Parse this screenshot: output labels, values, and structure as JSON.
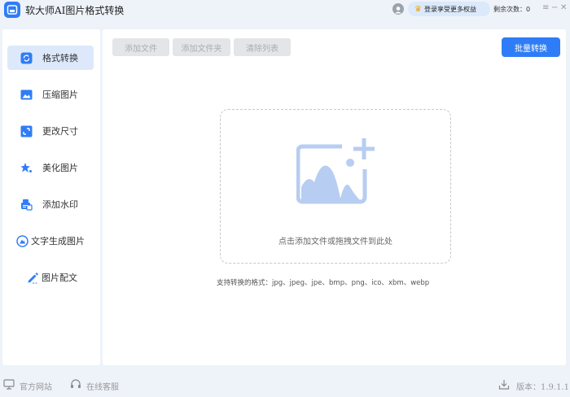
{
  "app": {
    "title": "软大师AI图片格式转换",
    "login_label": "登录享受更多权益",
    "remaining_label": "剩余次数：0"
  },
  "window": {
    "menu_glyph": "≡",
    "minimize_glyph": "−",
    "close_glyph": "✕"
  },
  "sidebar": {
    "items": [
      {
        "label": "格式转换",
        "icon": "refresh-icon",
        "active": true
      },
      {
        "label": "压缩图片",
        "icon": "image-icon",
        "active": false
      },
      {
        "label": "更改尺寸",
        "icon": "resize-icon",
        "active": false
      },
      {
        "label": "美化图片",
        "icon": "sparkle-icon",
        "active": false
      },
      {
        "label": "添加水印",
        "icon": "watermark-icon",
        "active": false
      },
      {
        "label": "文字生成图片",
        "icon": "text-image-icon",
        "active": false
      },
      {
        "label": "图片配文",
        "icon": "pen-icon",
        "active": false
      }
    ]
  },
  "toolbar": {
    "add_file": "添加文件",
    "add_folder": "添加文件夹",
    "clear_list": "清除列表",
    "batch_convert": "批量转换"
  },
  "dropzone": {
    "hint": "点击添加文件或拖拽文件到此处",
    "supported_formats": "支持转换的格式：jpg、jpeg、jpe、bmp、png、ico、xbm、webp"
  },
  "footer": {
    "website": "官方网站",
    "support": "在线客服",
    "version": "版本：1.9.1.1"
  },
  "colors": {
    "accent": "#2f7df6",
    "accent_light": "#dde9fb",
    "background": "#eef3fa"
  }
}
